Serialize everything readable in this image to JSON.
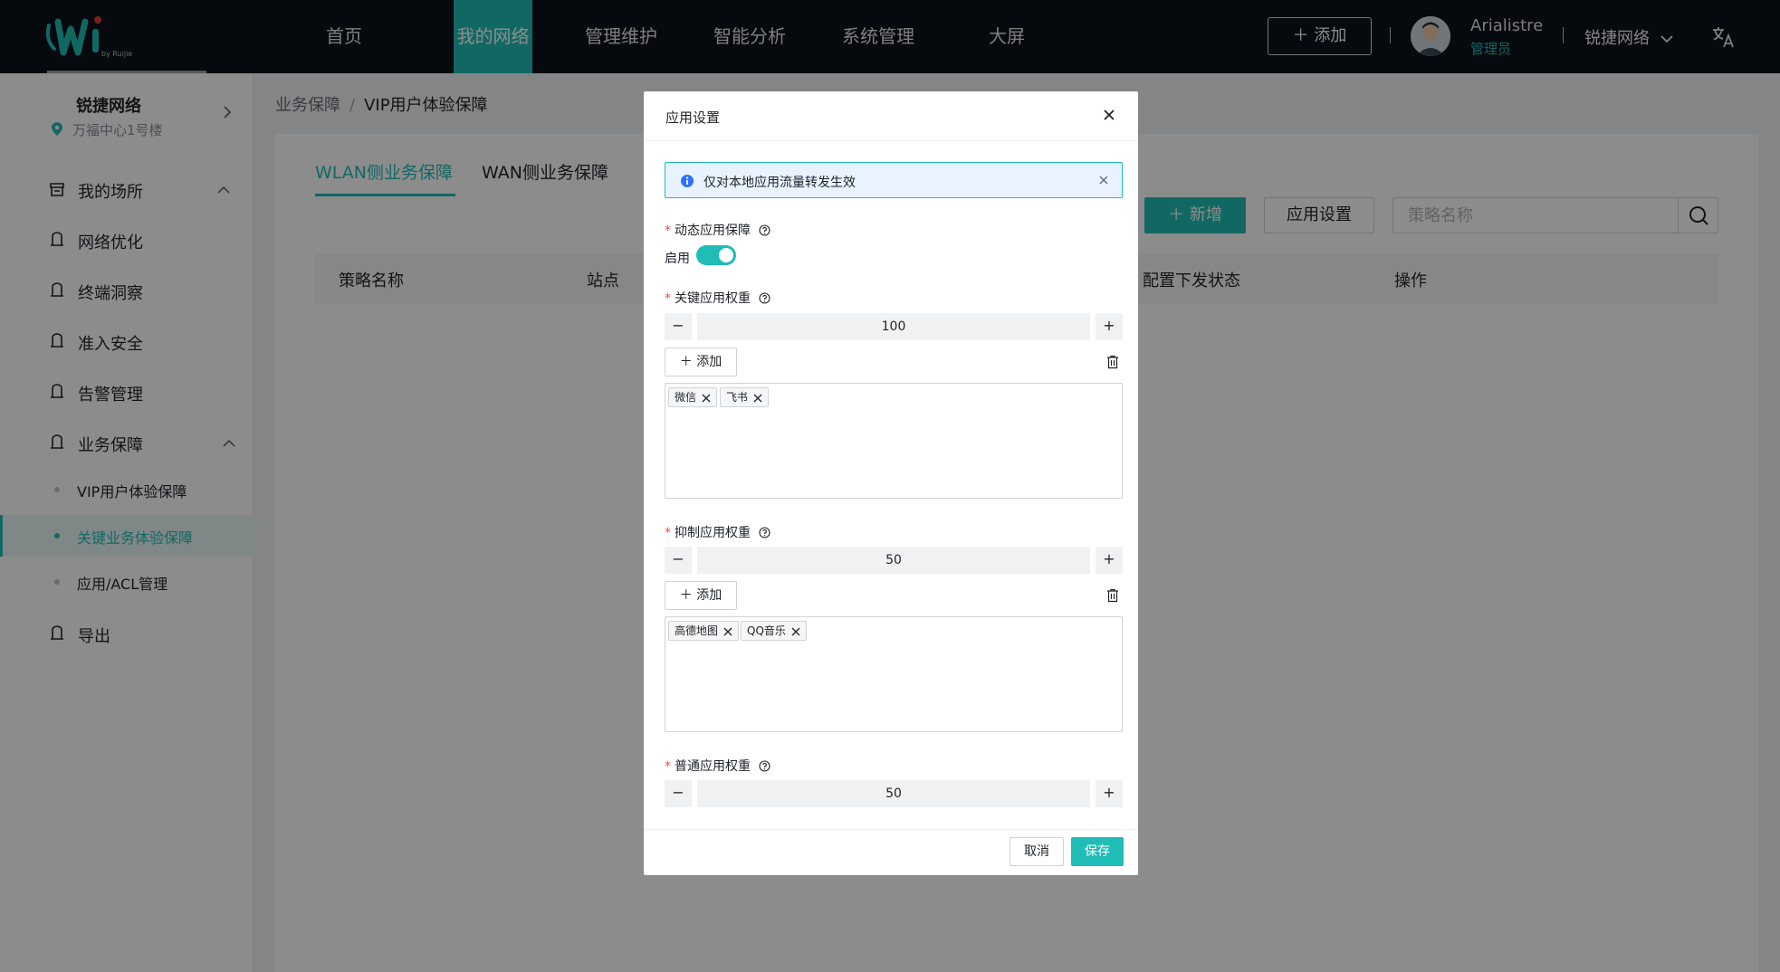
{
  "nav": {
    "items": [
      {
        "label": "首页"
      },
      {
        "label": "我的网络"
      },
      {
        "label": "管理维护"
      },
      {
        "label": "智能分析"
      },
      {
        "label": "系统管理"
      },
      {
        "label": "大屏"
      }
    ],
    "active_index": 1,
    "add_label": "添加",
    "user_name": "Arialistre",
    "user_role": "管理员",
    "org_label": "锐捷网络",
    "logo_sub": "by Ruijie",
    "accent": "#1fbdb5"
  },
  "sidebar": {
    "site_name": "锐捷网络",
    "site_location": "万福中心1号楼",
    "menu": [
      {
        "label": "我的场所",
        "icon": "store-icon"
      },
      {
        "label": "网络优化",
        "icon": "bell-icon"
      },
      {
        "label": "终端洞察",
        "icon": "bell-icon"
      },
      {
        "label": "准入安全",
        "icon": "bell-icon"
      },
      {
        "label": "告警管理",
        "icon": "bell-icon"
      },
      {
        "label": "业务保障",
        "icon": "bell-icon"
      }
    ],
    "submenu": [
      {
        "label": "VIP用户体验保障"
      },
      {
        "label": "关键业务体验保障"
      },
      {
        "label": "应用/ACL管理"
      }
    ],
    "export_label": "导出"
  },
  "main": {
    "breadcrumb": [
      "业务保障",
      "VIP用户体验保障"
    ],
    "tabs": [
      {
        "label": "WLAN侧业务保障"
      },
      {
        "label": "WAN侧业务保障"
      }
    ],
    "new_label": "新增",
    "app_settings_label": "应用设置",
    "search_placeholder": "策略名称",
    "columns": [
      "策略名称",
      "站点",
      "配置下发状态",
      "操作"
    ]
  },
  "modal": {
    "title": "应用设置",
    "alert": "仅对本地应用流量转发生效",
    "dynamic_label": "动态应用保障",
    "enable_label": "启用",
    "enabled": true,
    "key_weight_label": "关键应用权重",
    "key_weight": "100",
    "key_apps": [
      "微信",
      "飞书"
    ],
    "suppress_weight_label": "抑制应用权重",
    "suppress_weight": "50",
    "suppress_apps": [
      "高德地图",
      "QQ音乐"
    ],
    "normal_weight_label": "普通应用权重",
    "normal_weight": "50",
    "add_label": "添加",
    "minus": "−",
    "plus": "+",
    "cancel_label": "取消",
    "save_label": "保存"
  }
}
